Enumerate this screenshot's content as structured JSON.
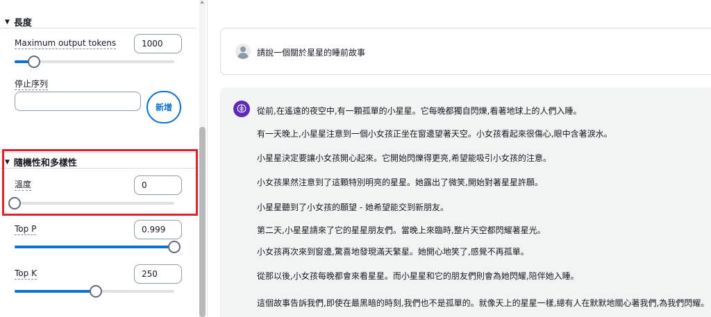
{
  "settings": {
    "length_section": {
      "title": "長度"
    },
    "max_tokens": {
      "label": "Maximum output tokens",
      "value": "1000",
      "slider_fraction": 0.12
    },
    "stop_sequence": {
      "label": "停止序列",
      "value": "",
      "add_button_label": "新增"
    },
    "randomness_section": {
      "title": "隨機性和多樣性"
    },
    "temperature": {
      "label": "溫度",
      "value": "0",
      "slider_fraction": 0.0
    },
    "top_p": {
      "label": "Top P",
      "value": "0.999",
      "slider_fraction": 1.0
    },
    "top_k": {
      "label": "Top K",
      "value": "250",
      "slider_fraction": 0.51
    }
  },
  "chat": {
    "user_message": "請說一個關於星星的睡前故事",
    "assistant_paragraphs": [
      "從前,在遙遠的夜空中,有一顆孤單的小星星。它每晚都獨自閃爍,看著地球上的人們入睡。",
      "有一天晚上,小星星注意到一個小女孩正坐在窗邊望著天空。小女孩看起來很傷心,眼中含著淚水。",
      "小星星決定要讓小女孩開心起來。它開始閃爍得更亮,希望能吸引小女孩的注意。",
      "小女孩果然注意到了這顆特別明亮的星星。她露出了微笑,開始對著星星許願。",
      "小星星聽到了小女孩的願望 - 她希望能交到新朋友。",
      "第二天,小星星請來了它的星星朋友們。當晚上來臨時,整片天空都閃耀著星光。",
      "小女孩再次來到窗邊,驚喜地發現滿天繁星。她開心地笑了,感覺不再孤單。",
      "從那以後,小女孩每晚都會來看星星。而小星星和它的朋友們則會為她閃耀,陪伴她入睡。",
      "這個故事告訴我們,即使在最黑暗的時刻,我們也不是孤單的。就像天上的星星一樣,總有人在默默地關心著我們,為我們閃耀。"
    ]
  },
  "colors": {
    "accent": "#0972d3",
    "highlight_border": "#e0202a",
    "assistant_icon": "#5d2bb5",
    "assistant_bg": "#f2f3f3"
  },
  "icons": {
    "section_toggle": "caret-down-icon",
    "user_avatar": "user-avatar-icon",
    "assistant_avatar": "assistant-brain-icon"
  }
}
